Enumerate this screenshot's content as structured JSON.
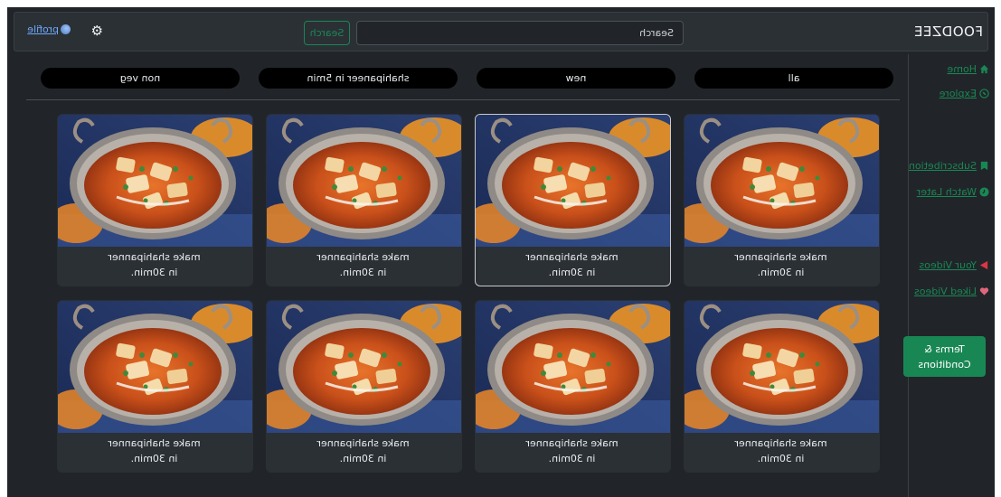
{
  "navbar": {
    "brand": "FOODZEE",
    "search_placeholder": "Search",
    "search_button": "Search",
    "settings_icon": "gear-icon",
    "profile_icon": "profile-image-icon",
    "profile_label": "profile"
  },
  "sidebar": {
    "items": [
      {
        "label": "Home",
        "icon": "home-icon",
        "color": "#198754"
      },
      {
        "label": "Explore",
        "icon": "compass-icon",
        "color": "#198754"
      },
      {
        "label": "Subscribetion",
        "icon": "subscription-icon",
        "color": "#198754"
      },
      {
        "label": "Watch Later",
        "icon": "clock-icon",
        "color": "#198754"
      },
      {
        "label": "Your Videos",
        "icon": "play-icon",
        "color": "#dc3545"
      },
      {
        "label": "Liked Videos",
        "icon": "heart-icon",
        "color": "#dc3545"
      }
    ],
    "terms_button": "Terms & Conditions"
  },
  "filters": [
    "all",
    "new",
    "shahipaneer in 5min",
    "non veg"
  ],
  "videos": [
    {
      "title_line1": "make shahipanner",
      "title_line2": "in 30min."
    },
    {
      "title_line1": "make shahipanner",
      "title_line2": "in 30min."
    },
    {
      "title_line1": "make shahipanner",
      "title_line2": "in 30min."
    },
    {
      "title_line1": "make shahipanner",
      "title_line2": "in 30min."
    },
    {
      "title_line1": "make shahipanner",
      "title_line2": "in 30min."
    },
    {
      "title_line1": "make shahipanner",
      "title_line2": "in 30min."
    },
    {
      "title_line1": "make shahipanner",
      "title_line2": "in 30min."
    },
    {
      "title_line1": "make shahipanner",
      "title_line2": "in 30min."
    }
  ],
  "colors": {
    "background": "#212529",
    "accent": "#198754",
    "link": "#6ea8fe",
    "danger": "#dc3545"
  }
}
